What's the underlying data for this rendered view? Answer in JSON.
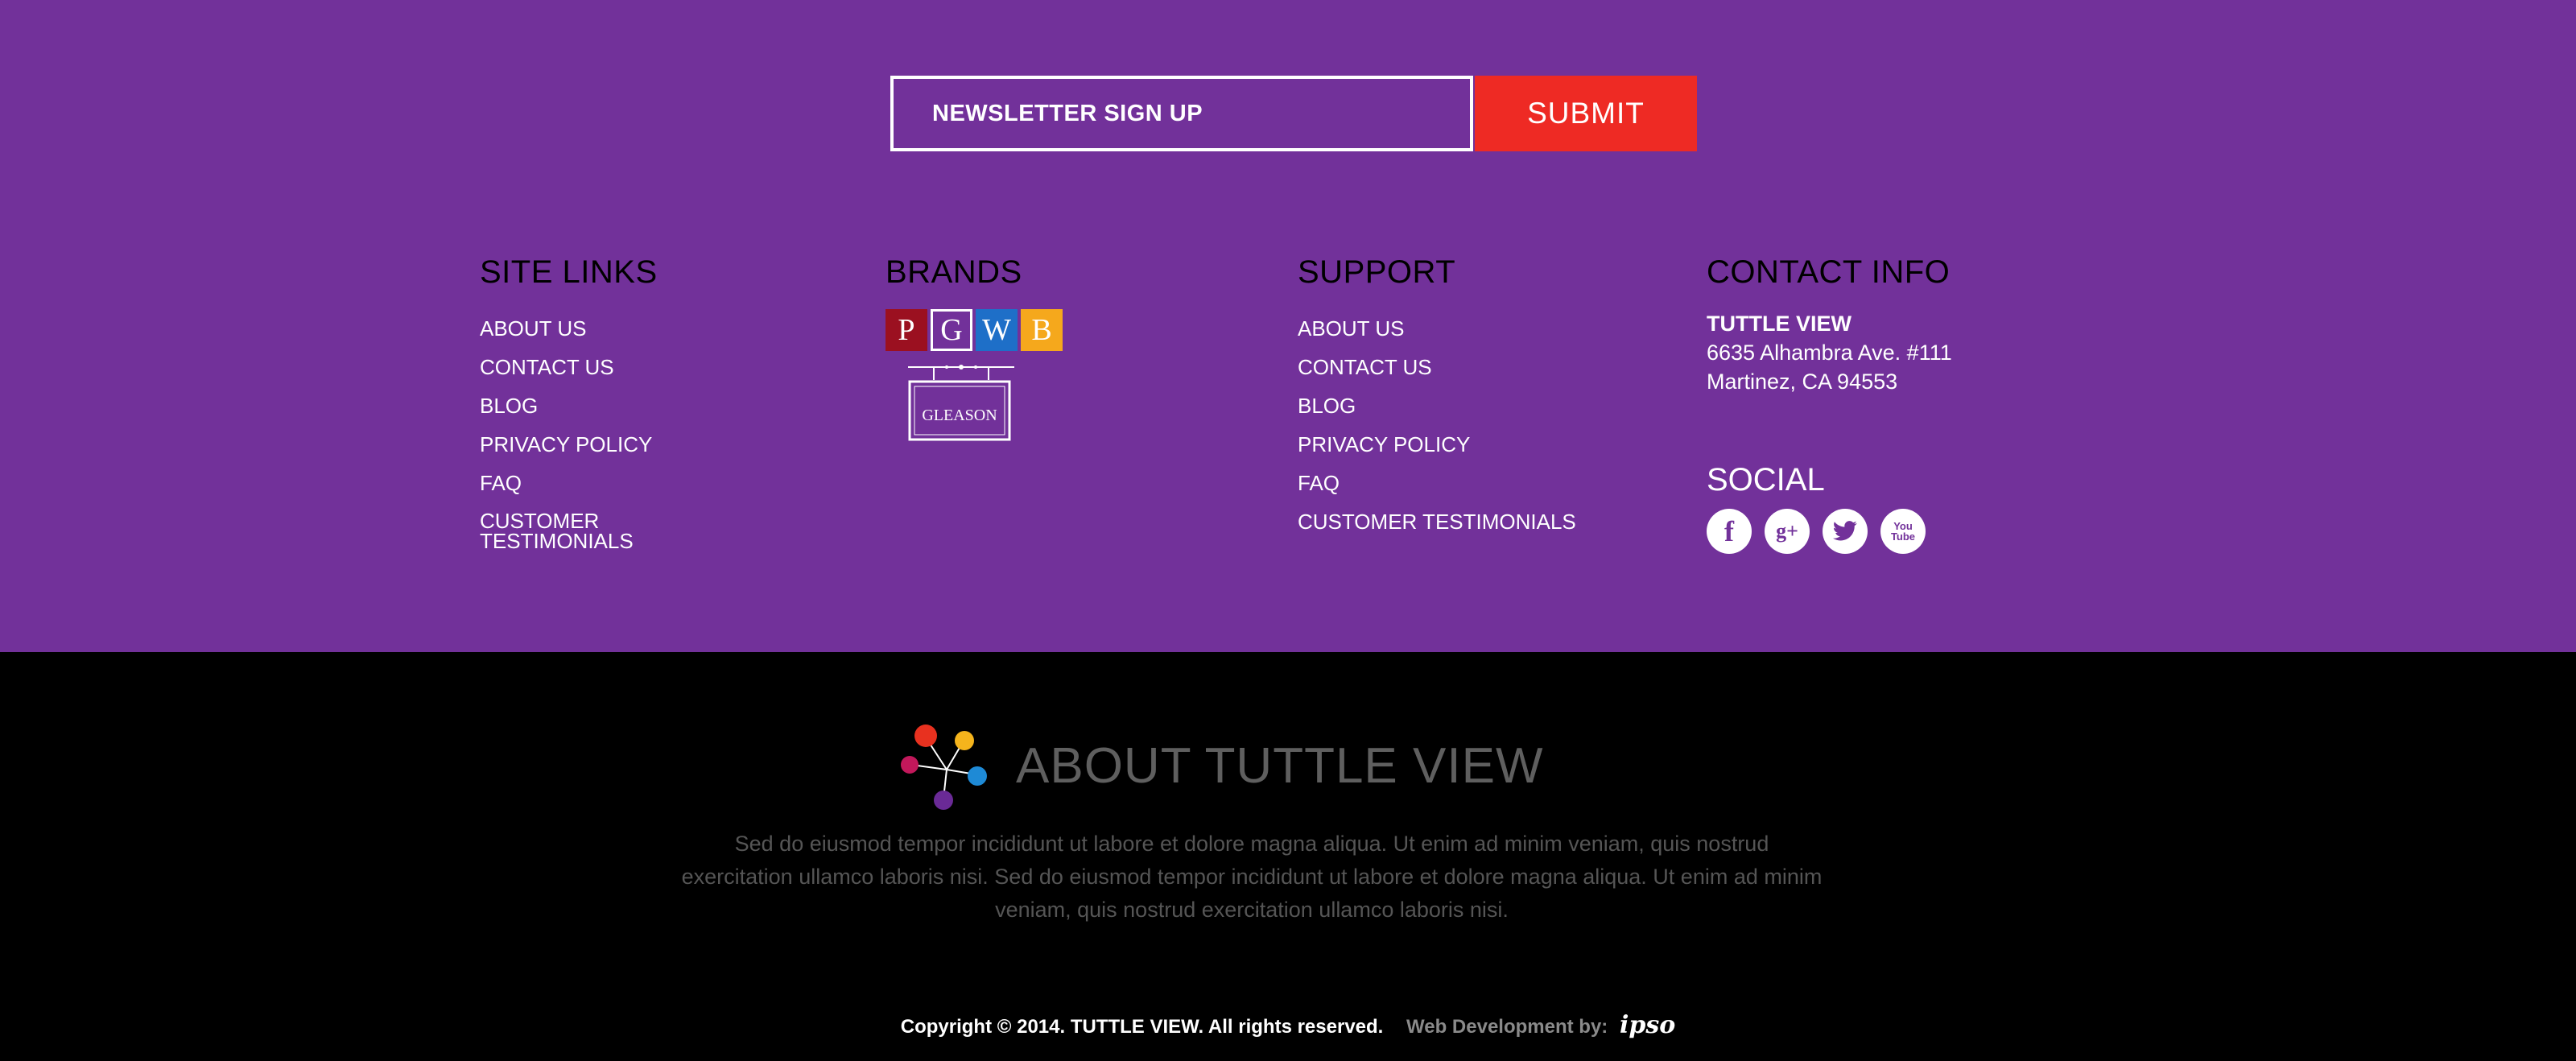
{
  "newsletter": {
    "placeholder": "NEWSLETTER SIGN UP",
    "submit_label": "SUBMIT"
  },
  "site_links": {
    "title": "SITE LINKS",
    "items": [
      "ABOUT US",
      "CONTACT US",
      "BLOG",
      "PRIVACY POLICY",
      "FAQ",
      "CUSTOMER TESTIMONIALS"
    ]
  },
  "brands": {
    "title": "BRANDS",
    "tiles": [
      {
        "letter": "P",
        "color": "#9b1020"
      },
      {
        "letter": "G",
        "color": "#72319a"
      },
      {
        "letter": "W",
        "color": "#1e6fc8"
      },
      {
        "letter": "B",
        "color": "#f5a81c"
      }
    ],
    "gleason_logo": "GLEASON"
  },
  "support": {
    "title": "SUPPORT",
    "items": [
      "ABOUT US",
      "CONTACT US",
      "BLOG",
      "PRIVACY POLICY",
      "FAQ",
      "CUSTOMER TESTIMONIALS"
    ]
  },
  "contact": {
    "title": "CONTACT INFO",
    "name": "TUTTLE VIEW",
    "address_line1": "6635 Alhambra Ave. #111",
    "address_line2": "Martinez, CA 94553"
  },
  "social": {
    "title": "SOCIAL",
    "icons": [
      {
        "name": "facebook-icon",
        "glyph": "f"
      },
      {
        "name": "google-plus-icon",
        "glyph": "g+"
      },
      {
        "name": "twitter-icon",
        "glyph": "t"
      },
      {
        "name": "youtube-icon",
        "glyph": "You Tube"
      }
    ]
  },
  "about": {
    "title": "ABOUT TUTTLE VIEW",
    "text": "Sed do eiusmod tempor incididunt ut labore et dolore magna aliqua. Ut enim ad minim veniam, quis nostrud exercitation ullamco laboris nisi. Sed do eiusmod tempor incididunt ut labore et dolore magna aliqua. Ut enim ad minim veniam, quis nostrud exercitation ullamco laboris nisi."
  },
  "footer": {
    "copyright": "Copyright © 2014. TUTTLE VIEW. All rights reserved.",
    "web_dev": "Web Development by:",
    "dev_logo": "ipso"
  },
  "colors": {
    "primary_purple": "#72319a",
    "submit_red": "#ee2a24",
    "footer_black": "#000000"
  }
}
